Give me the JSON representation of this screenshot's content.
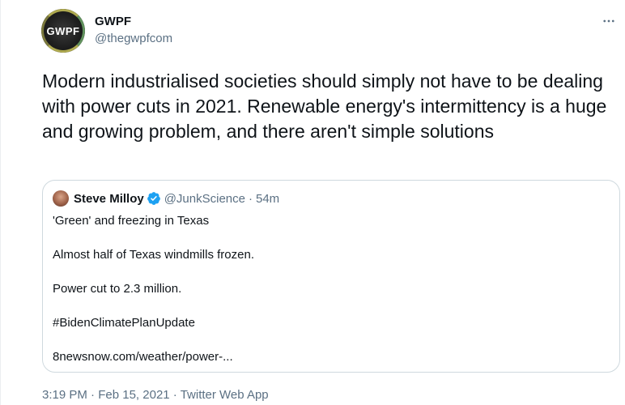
{
  "author": {
    "display_name": "GWPF",
    "handle": "@thegwpfcom",
    "avatar_text": "GWPF",
    "avatar_icon": "gwpf-logo"
  },
  "tweet": {
    "text": "Modern industrialised societies should simply not have to be dealing with power cuts in 2021. Renewable energy's intermittency is a huge and growing problem, and there aren't simple solutions"
  },
  "quoted": {
    "display_name": "Steve Milloy",
    "verified": true,
    "handle": "@JunkScience",
    "separator": "·",
    "time": "54m",
    "lines": [
      "'Green' and freezing in Texas",
      "Almost half of Texas windmills frozen.",
      "Power cut to 2.3 million.",
      "#BidenClimatePlanUpdate",
      "8newsnow.com/weather/power-..."
    ]
  },
  "meta": {
    "time": "3:19 PM",
    "sep1": "·",
    "date": "Feb 15, 2021",
    "sep2": "·",
    "source": "Twitter Web App"
  },
  "colors": {
    "text_primary": "#0f1419",
    "text_secondary": "#5b7083",
    "border": "#cfd9de",
    "verified_blue": "#1da1f2"
  },
  "icons": {
    "more": "more-horizontal-icon",
    "verified": "verified-badge-icon"
  }
}
